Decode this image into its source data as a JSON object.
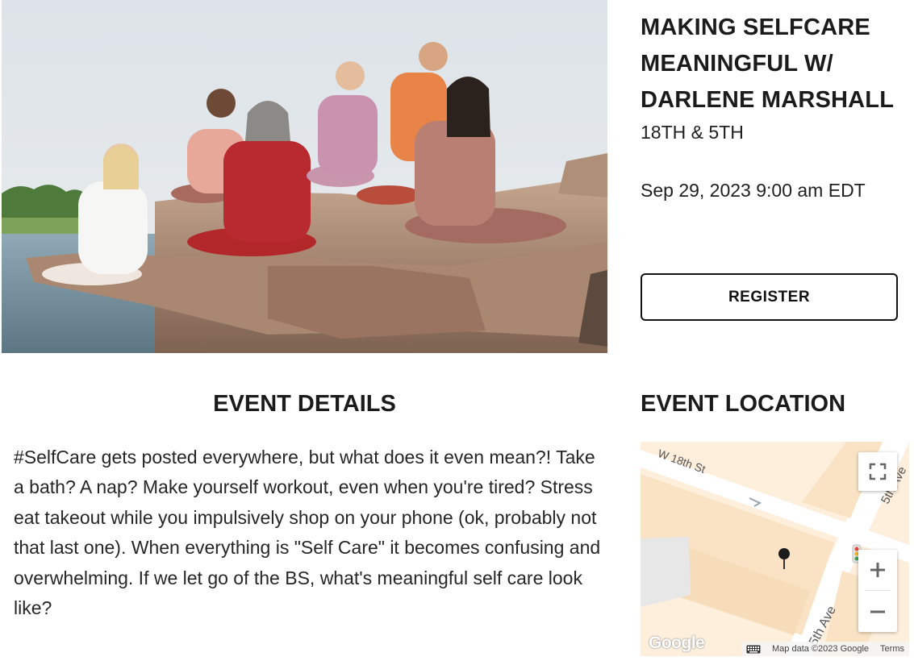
{
  "event": {
    "title": "MAKING SELFCARE MEANINGFUL W/ DARLENE MARSHALL",
    "venue": "18TH & 5TH",
    "datetime": "Sep 29, 2023 9:00 am EDT",
    "register_label": "REGISTER"
  },
  "hero": {
    "alt_icon": "hero-image"
  },
  "sections": {
    "details_heading": "EVENT DETAILS",
    "location_heading": "EVENT LOCATION"
  },
  "description": "#SelfCare gets posted everywhere, but what does it even mean?! Take a bath? A nap? Make yourself workout, even when you're tired? Stress eat takeout while you impulsively shop on your phone (ok, probably not that last one). When everything is \"Self Care\" it becomes confusing and overwhelming. If we let go of the BS, what's meaningful self care look like?",
  "map": {
    "street_top": "W 18th St",
    "street_right_top": "5th Ave",
    "street_bottom": "5th Ave",
    "logo": "Google",
    "attribution": "Map data ©2023 Google",
    "terms": "Terms",
    "icons": {
      "fullscreen": "fullscreen-icon",
      "zoom_in": "plus-icon",
      "zoom_out": "minus-icon",
      "pin": "map-pin-icon",
      "keyboard": "keyboard-icon",
      "traffic_light": "traffic-light-icon"
    }
  },
  "colors": {
    "map_land": "#fdefdc",
    "map_road": "#ffffff",
    "text": "#1b1b1b"
  }
}
